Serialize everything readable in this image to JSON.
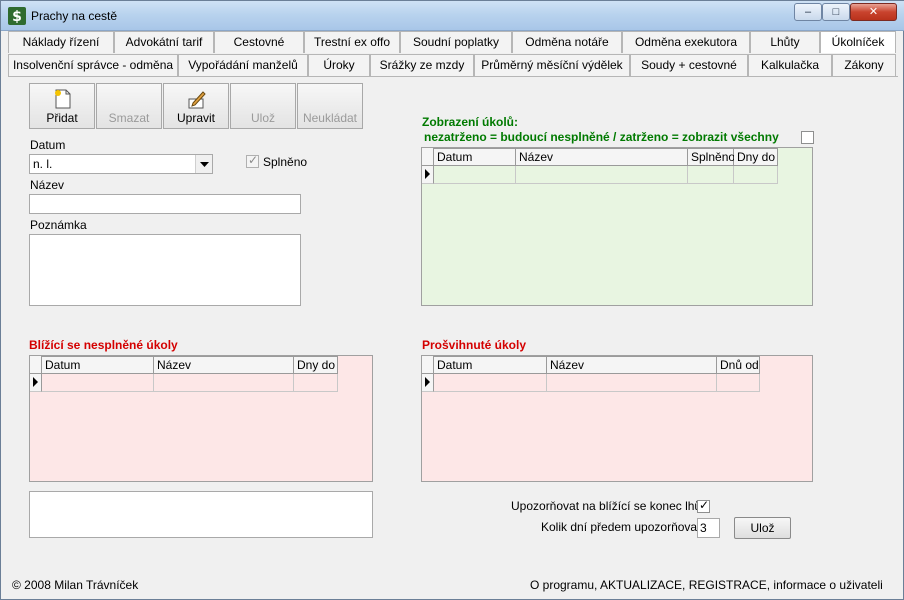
{
  "window": {
    "title": "Prachy na cestě",
    "controls": {
      "minimize": "–",
      "maximize": "□",
      "close": "✕"
    }
  },
  "tabs": {
    "row1": [
      "Náklady řízení",
      "Advokátní tarif",
      "Cestovné",
      "Trestní ex offo",
      "Soudní poplatky",
      "Odměna notáře",
      "Odměna exekutora",
      "Lhůty",
      "Úkolníček"
    ],
    "row2": [
      "Insolvenční správce - odměna",
      "Vypořádání manželů",
      "Úroky",
      "Srážky ze mzdy",
      "Průměrný měsíční výdělek",
      "Soudy + cestovné",
      "Kalkulačka",
      "Zákony"
    ],
    "active": "Úkolníček"
  },
  "toolbar": {
    "add": "Přidat",
    "delete": "Smazat",
    "edit": "Upravit",
    "save": "Ulož",
    "discard": "Neukládat"
  },
  "form": {
    "date_label": "Datum",
    "date_value": "n. l.",
    "done_label": "Splněno",
    "done_checked": true,
    "name_label": "Název",
    "name_value": "",
    "note_label": "Poznámka",
    "note_value": ""
  },
  "tasks_view": {
    "title": "Zobrazení úkolů:",
    "hint": "nezatrženo = budoucí nesplněné / zatrženo = zobrazit všechny",
    "show_all_checked": false,
    "columns": [
      "Datum",
      "Název",
      "Splněno",
      "Dny do"
    ]
  },
  "upcoming": {
    "title": "Blížící se nesplněné úkoly",
    "columns": [
      "Datum",
      "Název",
      "Dny do"
    ]
  },
  "overdue": {
    "title": "Prošvihnuté úkoly",
    "columns": [
      "Datum",
      "Název",
      "Dnů od"
    ]
  },
  "settings": {
    "notify_label": "Upozorňovat na blížící se konec lhůt",
    "notify_checked": true,
    "days_label": "Kolik dní předem upozorňovat",
    "days_value": "3",
    "save_label": "Ulož"
  },
  "footer": {
    "copyright": "© 2008 Milan Trávníček",
    "about": "O programu, AKTUALIZACE, REGISTRACE, informace o uživateli"
  },
  "colors": {
    "tasks_bg": "#e8f5e1",
    "alert_bg": "#fde7e7",
    "red_title": "#d40000",
    "green_title": "#007a00"
  }
}
